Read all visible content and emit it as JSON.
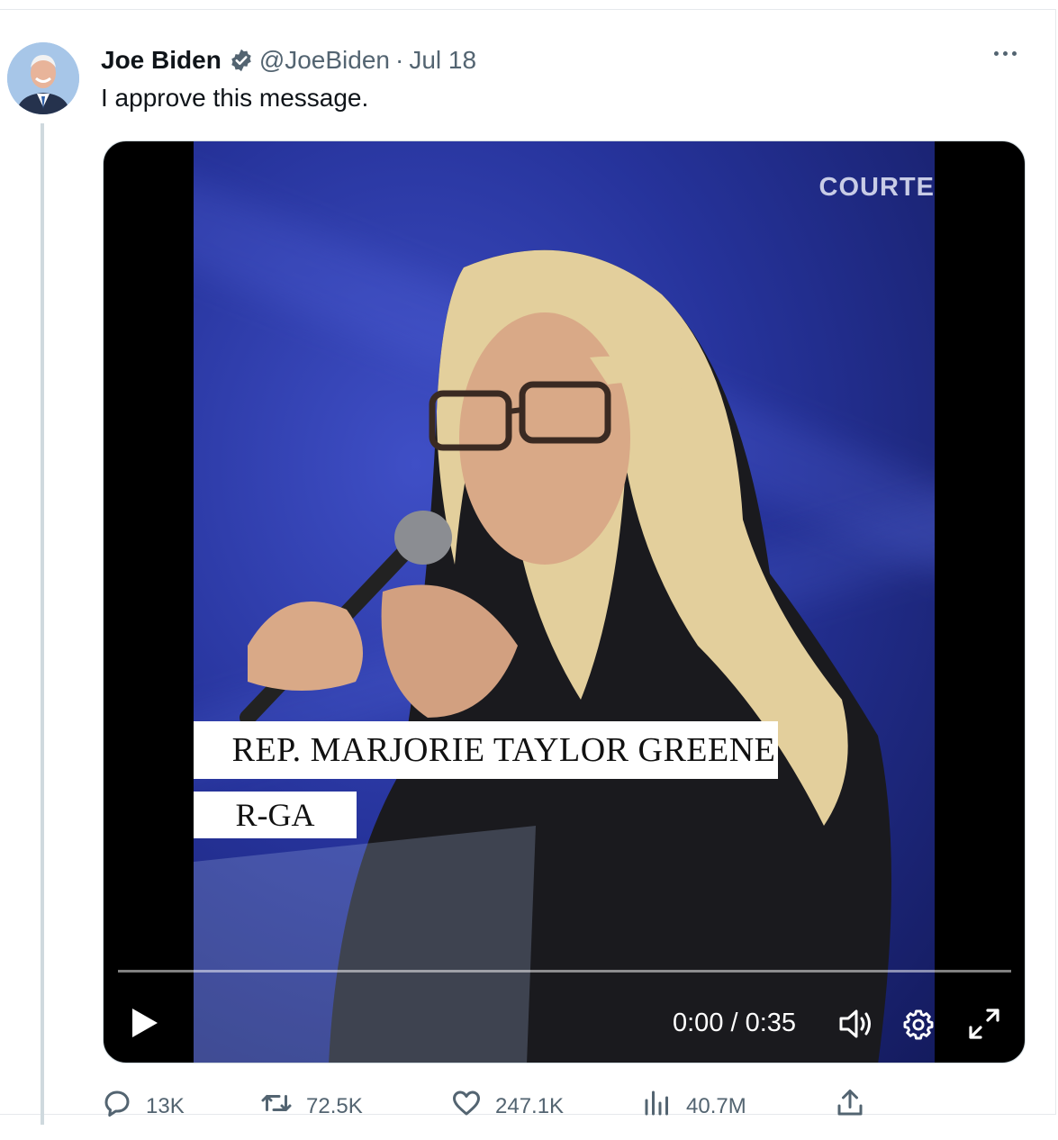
{
  "tweet": {
    "author_name": "Joe Biden",
    "handle": "@JoeBiden",
    "separator": "·",
    "date": "Jul 18",
    "text": "I approve this message."
  },
  "video": {
    "watermark": "COURTE",
    "lower_third_name": "REP. MARJORIE TAYLOR GREENE",
    "lower_third_party": "R-GA",
    "time": "0:00 / 0:35",
    "progress": 0
  },
  "actions": {
    "replies": "13K",
    "retweets": "72.5K",
    "likes": "247.1K",
    "views": "40.7M"
  },
  "icons": {
    "verified": "verified-badge-icon",
    "more": "more-icon",
    "play": "play-icon",
    "volume": "volume-icon",
    "settings": "gear-icon",
    "fullscreen": "fullscreen-icon",
    "reply": "reply-icon",
    "retweet": "retweet-icon",
    "like": "heart-icon",
    "views": "views-icon",
    "share": "share-icon"
  },
  "colors": {
    "verified": "#1d9bf0",
    "text_secondary": "#536471"
  }
}
